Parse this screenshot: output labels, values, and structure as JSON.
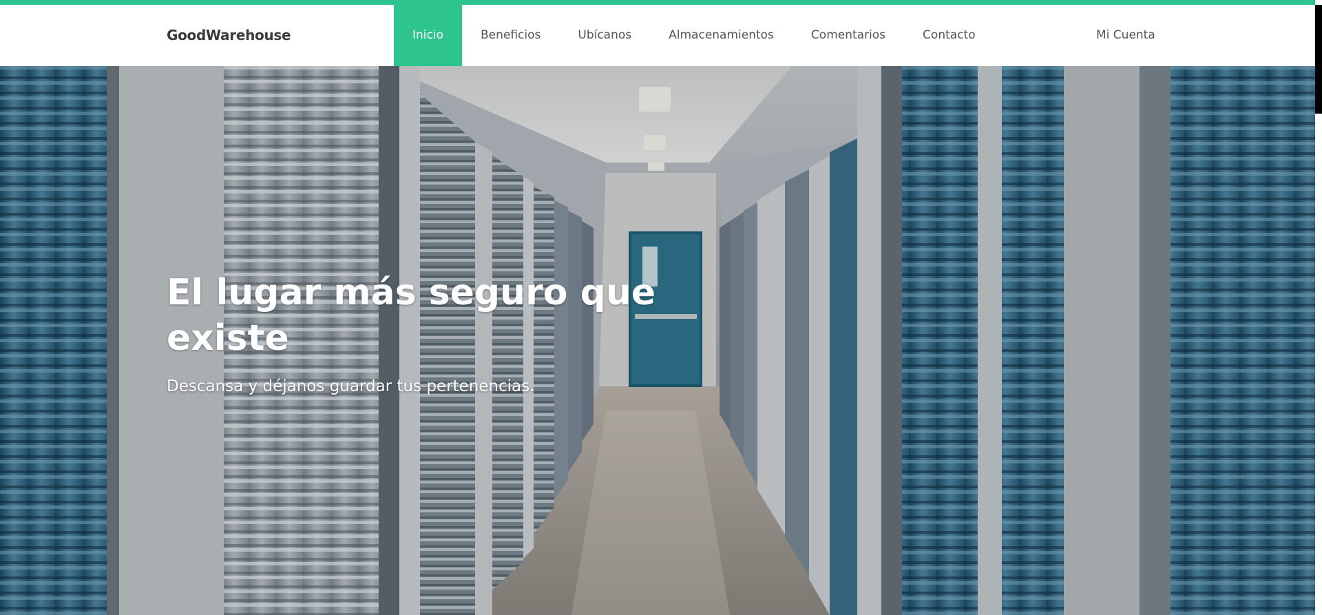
{
  "brand": {
    "name": "GoodWarehouse"
  },
  "nav": {
    "items": [
      {
        "label": "Inicio",
        "active": true
      },
      {
        "label": "Beneficios",
        "active": false
      },
      {
        "label": "Ubícanos",
        "active": false
      },
      {
        "label": "Almacenamientos",
        "active": false
      },
      {
        "label": "Comentarios",
        "active": false
      },
      {
        "label": "Contacto",
        "active": false
      }
    ],
    "account_label": "Mi Cuenta"
  },
  "hero": {
    "title": "El lugar más seguro que existe",
    "subtitle": "Descansa y déjanos guardar tus pertenencias.",
    "image": "storage-units-corridor-photo"
  },
  "colors": {
    "accent": "#2ec48d",
    "nav_text": "#555555",
    "brand_text": "#3a3a3a",
    "hero_text": "#ffffff",
    "door_blue": "#2f6f8a"
  }
}
